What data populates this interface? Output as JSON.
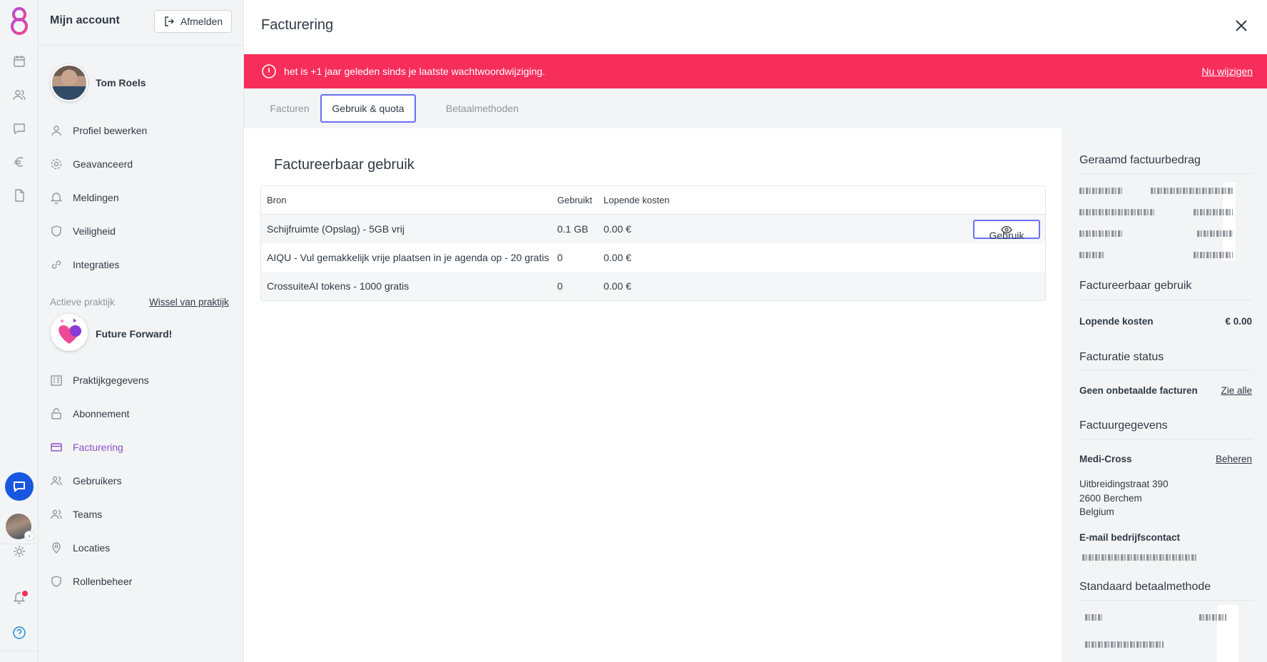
{
  "sidebar": {
    "title": "Mijn account",
    "logout_label": "Afmelden",
    "user_name": "Tom Roels",
    "account_items": [
      {
        "label": "Profiel bewerken",
        "icon": "user-icon"
      },
      {
        "label": "Geavanceerd",
        "icon": "gear-icon"
      },
      {
        "label": "Meldingen",
        "icon": "bell-icon"
      },
      {
        "label": "Veiligheid",
        "icon": "shield-icon"
      },
      {
        "label": "Integraties",
        "icon": "link-icon"
      }
    ],
    "practice_label": "Actieve praktijk",
    "switch_practice_label": "Wissel van praktijk",
    "practice_name": "Future Forward!",
    "practice_items": [
      {
        "label": "Praktijkgegevens",
        "icon": "building-icon"
      },
      {
        "label": "Abonnement",
        "icon": "lock-icon"
      },
      {
        "label": "Facturering",
        "icon": "credit-card-icon",
        "active": true
      },
      {
        "label": "Gebruikers",
        "icon": "users-icon"
      },
      {
        "label": "Teams",
        "icon": "team-icon"
      },
      {
        "label": "Locaties",
        "icon": "location-pin-icon"
      },
      {
        "label": "Rollenbeheer",
        "icon": "shield-icon"
      }
    ]
  },
  "main": {
    "title": "Facturering",
    "alert": {
      "message": "het is +1 jaar geleden sinds je laatste wachtwoordwijziging.",
      "link": "Nu wijzigen",
      "color": "#f72d5b"
    },
    "tabs": [
      {
        "label": "Facturen",
        "active": false
      },
      {
        "label": "Gebruik & quota",
        "active": true
      },
      {
        "label": "Betaalmethoden",
        "active": false
      }
    ],
    "section_title": "Factureerbaar gebruik",
    "table": {
      "headers": [
        "Bron",
        "Gebruikt",
        "Lopende kosten"
      ],
      "rows": [
        {
          "bron": "Schijfruimte (Opslag) - 5GB vrij",
          "gebruikt": "0.1 GB",
          "kosten": "0.00 €",
          "action": "Gebruik"
        },
        {
          "bron": "AIQU - Vul gemakkelijk vrije plaatsen in je agenda op - 20 gratis",
          "gebruikt": "0",
          "kosten": "0.00 €"
        },
        {
          "bron": "CrossuiteAI tokens - 1000 gratis",
          "gebruikt": "0",
          "kosten": "0.00 €"
        }
      ]
    }
  },
  "right_panel": {
    "estimate_title": "Geraamd factuurbedrag",
    "usage_title": "Factureerbaar gebruik",
    "running_costs_label": "Lopende kosten",
    "running_costs_value": "€ 0.00",
    "status_title": "Facturatie status",
    "status_text": "Geen onbetaalde facturen",
    "status_link": "Zie alle",
    "billing_title": "Factuurgegevens",
    "company": "Medi-Cross",
    "manage_link": "Beheren",
    "address_line1": "Uitbreidingstraat 390",
    "address_line2": "2600 Berchem",
    "address_line3": "Belgium",
    "email_label": "E-mail bedrijfscontact",
    "payment_title": "Standaard betaalmethode"
  },
  "colors": {
    "accent": "#8a4fc7",
    "focus": "#6b6ff2",
    "chat": "#1a57e0"
  }
}
